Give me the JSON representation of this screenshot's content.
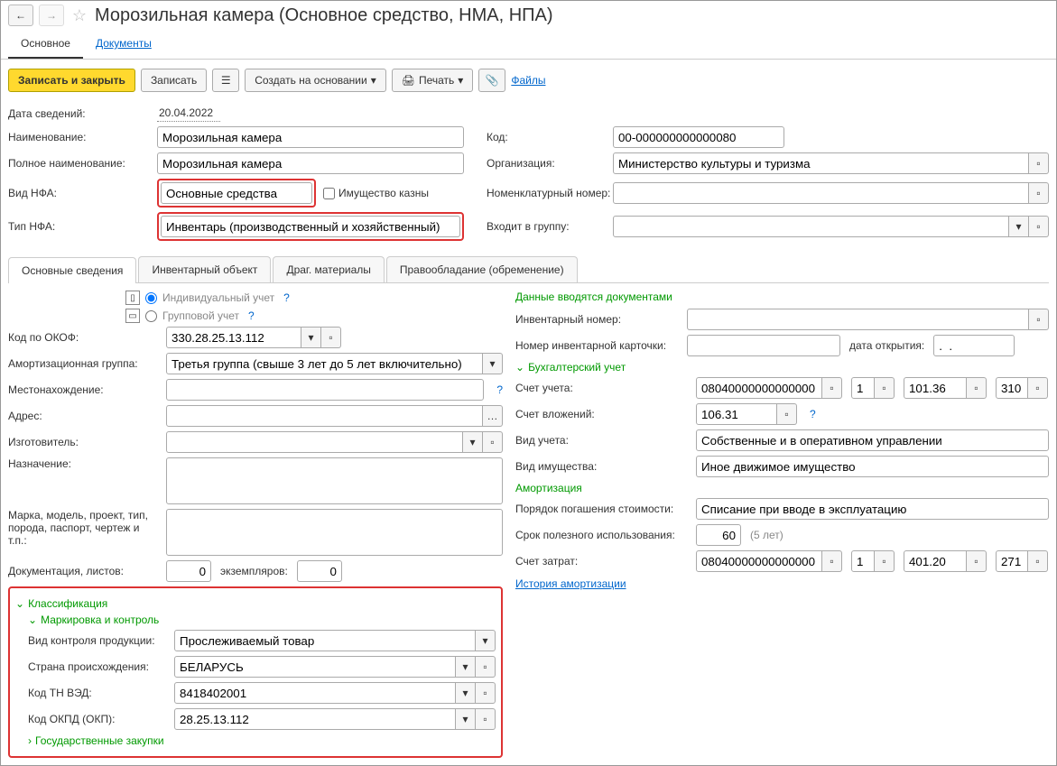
{
  "header": {
    "title": "Морозильная камера (Основное средство, НМА, НПА)"
  },
  "navTabs": {
    "main": "Основное",
    "documents": "Документы"
  },
  "toolbar": {
    "saveClose": "Записать и закрыть",
    "save": "Записать",
    "createFrom": "Создать на основании",
    "print": "Печать",
    "files": "Файлы"
  },
  "fields": {
    "dateLabel": "Дата сведений:",
    "dateValue": "20.04.2022",
    "nameLabel": "Наименование:",
    "nameValue": "Морозильная камера",
    "codeLabel": "Код:",
    "codeValue": "00-000000000000080",
    "fullNameLabel": "Полное наименование:",
    "fullNameValue": "Морозильная камера",
    "orgLabel": "Организация:",
    "orgValue": "Министерство культуры и туризма",
    "nfaKindLabel": "Вид НФА:",
    "nfaKindValue": "Основные средства",
    "treasuryLabel": "Имущество казны",
    "nomNumLabel": "Номенклатурный номер:",
    "nfaTypeLabel": "Тип НФА:",
    "nfaTypeValue": "Инвентарь (производственный и хозяйственный)",
    "groupLabel": "Входит в группу:"
  },
  "tabs2": {
    "t1": "Основные сведения",
    "t2": "Инвентарный объект",
    "t3": "Драг. материалы",
    "t4": "Правообладание (обременение)"
  },
  "left": {
    "radioInd": "Индивидуальный учет",
    "radioGrp": "Групповой учет",
    "okofLabel": "Код по ОКОФ:",
    "okofValue": "330.28.25.13.112",
    "amortGrpLabel": "Амортизационная группа:",
    "amortGrpValue": "Третья группа (свыше 3 лет до 5 лет включительно)",
    "locationLabel": "Местонахождение:",
    "addressLabel": "Адрес:",
    "makerLabel": "Изготовитель:",
    "purposeLabel": "Назначение:",
    "modelLabel": "Марка, модель, проект, тип, порода, паспорт, чертеж и т.п.:",
    "docsLabel": "Документация, листов:",
    "docsValue": "0",
    "copiesLabel": "экземпляров:",
    "copiesValue": "0",
    "classification": "Классификация",
    "marking": "Маркировка и контроль",
    "controlKindLabel": "Вид контроля продукции:",
    "controlKindValue": "Прослеживаемый товар",
    "countryLabel": "Страна происхождения:",
    "countryValue": "БЕЛАРУСЬ",
    "tnvedLabel": "Код ТН ВЭД:",
    "tnvedValue": "8418402001",
    "okpdLabel": "Код ОКПД (ОКП):",
    "okpdValue": "28.25.13.112",
    "gosZakup": "Государственные закупки"
  },
  "right": {
    "docDataTitle": "Данные вводятся документами",
    "invNumLabel": "Инвентарный номер:",
    "cardNumLabel": "Номер инвентарной карточки:",
    "openDateLabel": "дата открытия:",
    "openDateValue": ".  .",
    "buhTitle": "Бухгалтерский учет",
    "accLabel": "Счет учета:",
    "accValue": "08040000000000000",
    "accSub1": "1",
    "accSub2": "101.36",
    "accSub3": "310",
    "invAccLabel": "Счет вложений:",
    "invAccValue": "106.31",
    "accKindLabel": "Вид учета:",
    "accKindValue": "Собственные и в оперативном управлении",
    "propKindLabel": "Вид имущества:",
    "propKindValue": "Иное движимое имущество",
    "amortTitle": "Амортизация",
    "repayLabel": "Порядок погашения стоимости:",
    "repayValue": "Списание при вводе в эксплуатацию",
    "lifeLabel": "Срок полезного использования:",
    "lifeValue": "60",
    "lifeYears": "(5 лет)",
    "costAccLabel": "Счет затрат:",
    "costAccValue": "08040000000000000",
    "costSub1": "1",
    "costSub2": "401.20",
    "costSub3": "271",
    "historyLink": "История амортизации"
  }
}
